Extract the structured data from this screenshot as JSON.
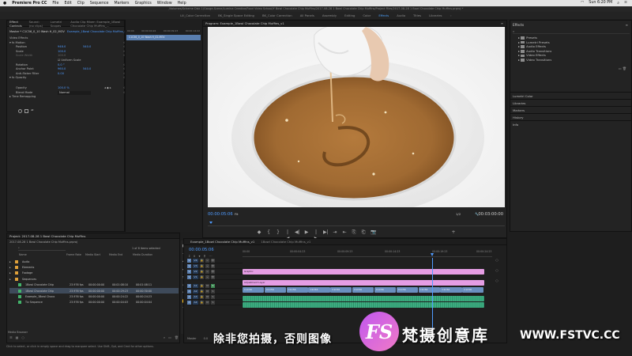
{
  "menubar": {
    "apple": "",
    "app": "Premiere Pro CC",
    "items": [
      "File",
      "Edit",
      "Clip",
      "Sequence",
      "Markers",
      "Graphics",
      "Window",
      "Help"
    ],
    "clock": "Sun 6:20 PM"
  },
  "titlebar": "/Volumes/Scheme Disk 1/Gauge-Scene/Lumina Creative/Food Video School/Y Bowl Chocolate Chip Muffins/2017-08-28 1 Bowl Chocolate Chip Muffins/Project Files/2017-08-28 1 Bowl Chocolate Chip Muffins.prproj *",
  "workspaces": [
    "Lili_Color Correction",
    "BK_Single Space Editing",
    "BK_Color Correction",
    "All Panels",
    "Assembly",
    "Editing",
    "Color",
    "Effects",
    "Audio",
    "Titles",
    "Libraries"
  ],
  "workspace_active": "Effects",
  "effect_controls": {
    "tabs": [
      "Effect Controls",
      "Sound: (no clips)",
      "Lumetri Scopes",
      "Audio Clip Mixer: Example_1Bowl Chocolate Chip Muffins_..."
    ],
    "sequence_label": "Master * C1C56_0_10 Wash H_02_MOV",
    "clip_label": "Example_1Bowl Chocolate Chip Muffins_v1",
    "video_effects": "Video Effects",
    "motion": "Motion",
    "position": {
      "label": "Position",
      "x": "948.0",
      "y": "540.0"
    },
    "scale": {
      "label": "Scale",
      "value": "100.0"
    },
    "scale_width": {
      "label": "Scale Width",
      "value": "100.0"
    },
    "uniform_scale": "Uniform Scale",
    "rotation": {
      "label": "Rotation",
      "value": "0.0 °"
    },
    "anchor": {
      "label": "Anchor Point",
      "x": "960.0",
      "y": "540.0"
    },
    "antiflicker": {
      "label": "Anti-flicker Filter",
      "value": "0.00"
    },
    "opacity": "Opacity",
    "opacity_value": {
      "label": "Opacity",
      "value": "100.0 %"
    },
    "blend": {
      "label": "Blend Mode",
      "value": "Normal"
    },
    "time_remap": "Time Remapping",
    "mini_ruler": [
      "00:00",
      "00:00:04:22",
      "00:00:09:23",
      "00:00:14:22"
    ],
    "mini_clip": "C1C56_0_10 Wash H_02.MOV"
  },
  "program": {
    "tabs": [
      "Program: Example_1Bowl Chocolate Chip Muffins_v1"
    ],
    "tc_left": "00:00:05:06",
    "fit": "Fit",
    "ratio": "1/2",
    "tc_right": "00:03:00:00",
    "buttons": [
      "◆",
      "{",
      "}",
      "|◀",
      "◀|",
      "▶",
      "|▶",
      "▶|",
      "⇥",
      "⇤",
      "⎘",
      "⎗",
      "📷",
      "+"
    ]
  },
  "effects_panel": {
    "title": "Effects",
    "menu": "≡",
    "search_icon": "⌕",
    "tree": [
      "Presets",
      "Lumetri Presets",
      "Audio Effects",
      "Audio Transitions",
      "Video Effects",
      "Video Transitions"
    ],
    "stack": [
      "Lumetri Color",
      "Libraries",
      "Markers",
      "History",
      "Info"
    ]
  },
  "project": {
    "tabs": [
      "Project: 2017-08-28 1 Bowl Chocolate Chip Muffins",
      "Media Browser"
    ],
    "file": "2017-08-28 1 Bowl Chocolate Chip Muffins.prproj",
    "search_icon": "⌕",
    "count": "1 of 8 items selected",
    "columns": [
      "Name",
      "Frame Rate",
      "Media Start",
      "Media End",
      "Media Duration"
    ],
    "rows": [
      {
        "name": "Audio",
        "rate": "",
        "ms": "",
        "me": "",
        "md": "",
        "color": "#e0a13a",
        "indent": 0,
        "sel": false
      },
      {
        "name": "Elements",
        "rate": "",
        "ms": "",
        "me": "",
        "md": "",
        "color": "#e0a13a",
        "indent": 0,
        "sel": false
      },
      {
        "name": "Footage",
        "rate": "",
        "ms": "",
        "me": "",
        "md": "",
        "color": "#e0a13a",
        "indent": 0,
        "sel": false
      },
      {
        "name": "Sequences",
        "rate": "",
        "ms": "",
        "me": "",
        "md": "",
        "color": "#e0a13a",
        "indent": 0,
        "sel": false
      },
      {
        "name": "1Bowl Chocolate Chip",
        "rate": "23.976 fps",
        "ms": "00:00:00:00",
        "me": "00:01:08:10",
        "md": "00:01:08:11",
        "color": "#43b36a",
        "indent": 1,
        "sel": false
      },
      {
        "name": "1Bowl Chocolate Chip",
        "rate": "23.976 fps",
        "ms": "00:00:00:00",
        "me": "00:00:29:23",
        "md": "00:00:30:00",
        "color": "#43b36a",
        "indent": 1,
        "sel": true
      },
      {
        "name": "Example_1Bowl Choco",
        "rate": "23.976 fps",
        "ms": "00:00:00:00",
        "me": "00:00:24:22",
        "md": "00:00:24:23",
        "color": "#43b36a",
        "indent": 1,
        "sel": false
      },
      {
        "name": "Tiz Sequence",
        "rate": "23.976 fps",
        "ms": "00:00:00:00",
        "me": "00:00:04:03",
        "md": "00:00:04:04",
        "color": "#43b36a",
        "indent": 1,
        "sel": false
      }
    ],
    "bottom": [
      "☰",
      "▦",
      "○",
      "⌕",
      "▭",
      "🗑"
    ]
  },
  "tools": [
    "▶",
    "⇥",
    "⇹",
    "◆",
    "✂",
    "⇿",
    "✎",
    "✋",
    "T"
  ],
  "timeline": {
    "tabs": [
      "Example_1Bowl Chocolate Chip Muffins_v1",
      "1Bowl Chocolate Chip Muffins_v1"
    ],
    "tc": "00:00:05:06",
    "tools": [
      "⟟",
      "∩",
      "▾",
      "⚲",
      "⋯"
    ],
    "ruler": [
      "00:00",
      "00:00:04:23",
      "00:00:09:23",
      "00:00:14:23",
      "00:00:19:23",
      "00:00:24:23"
    ],
    "tracks": [
      {
        "id": "V4",
        "icons": [
          "🔒",
          "⌸",
          "👁"
        ]
      },
      {
        "id": "V3",
        "icons": [
          "🔒",
          "⌸",
          "👁"
        ]
      },
      {
        "id": "V2",
        "icons": [
          "🔒",
          "⌸",
          "👁"
        ]
      },
      {
        "id": "V1",
        "icons": [
          "🔒",
          "⌸",
          "👁"
        ]
      },
      {
        "id": "A1",
        "icons": [
          "🔒",
          "M",
          "S"
        ]
      },
      {
        "id": "A2",
        "icons": [
          "🔒",
          "M",
          "S"
        ]
      },
      {
        "id": "A3",
        "icons": [
          "🔒",
          "M",
          "S"
        ]
      },
      {
        "id": "A4",
        "icons": [
          "🔒",
          "M",
          "S"
        ]
      }
    ],
    "clips": {
      "graphic": "Graphic",
      "adjustment": "Adjustment Layer",
      "v1_labels": [
        "C1C56",
        "C1C56",
        "C1C56",
        "C1C56",
        "C1C56",
        "C1C56",
        "C1C56",
        "C1C56",
        "C1C56",
        "C1C56",
        "C1C56"
      ]
    },
    "master": "Master",
    "master_value": "0.0"
  },
  "status": "Click to select, or click in empty space and drag to marquee select. Use Shift, Opt, and Cmd for other options.",
  "subtitle": "除非您拍摄，否则图像",
  "watermark": {
    "logo": "FS",
    "brand": "梵摄创意库",
    "url": "WWW.FSTVC.CC"
  }
}
